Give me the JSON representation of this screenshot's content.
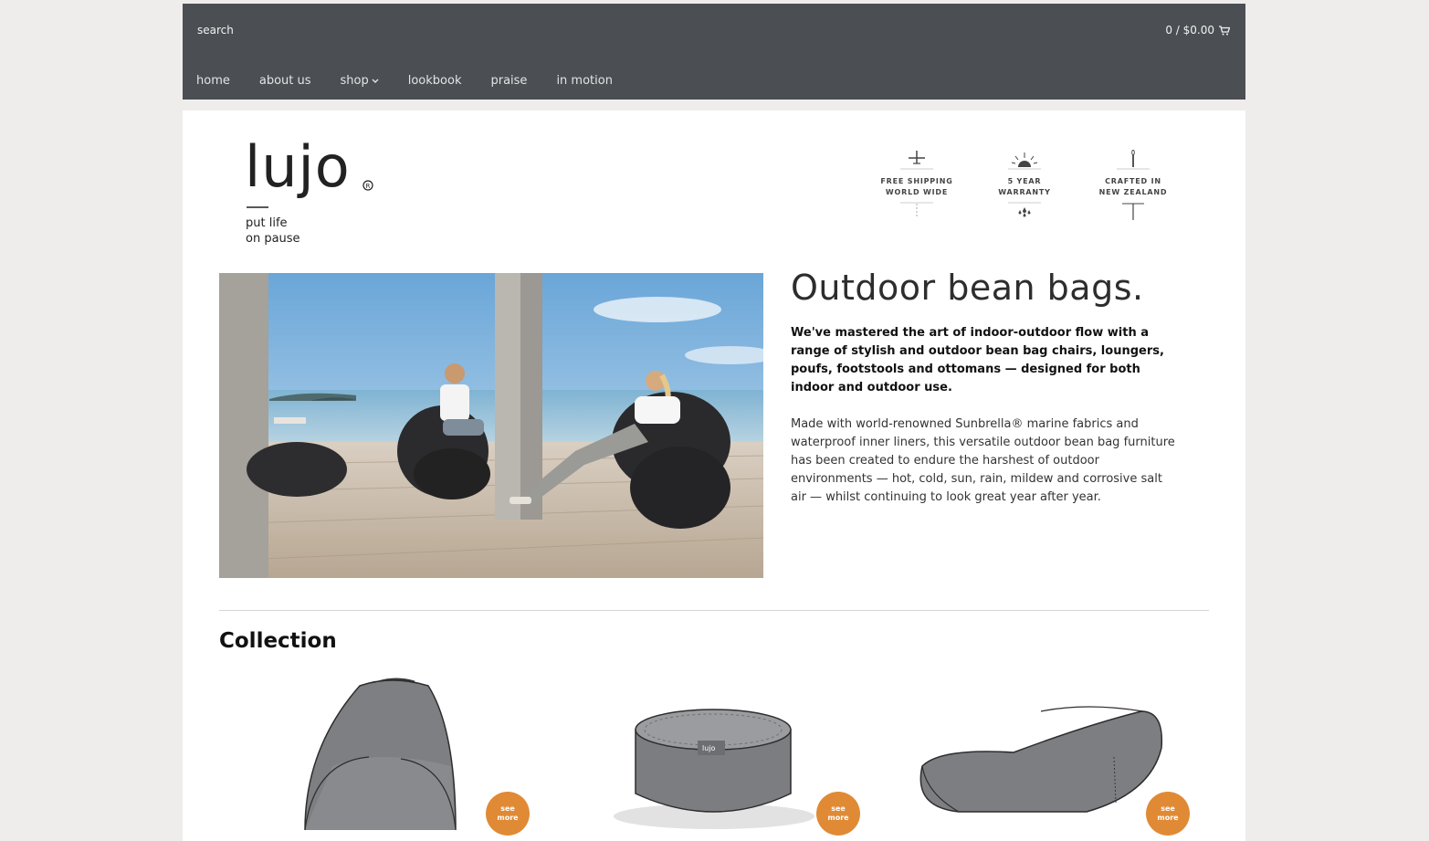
{
  "header": {
    "search_placeholder": "search",
    "cart": "0 / $0.00",
    "nav": [
      "home",
      "about us",
      "shop",
      "lookbook",
      "praise",
      "in motion"
    ]
  },
  "brand": {
    "logo": "lujo",
    "tagline_line1": "put life",
    "tagline_line2": "on pause"
  },
  "badges": [
    {
      "line1": "FREE SHIPPING",
      "line2": "WORLD WIDE",
      "icon": "plane-icon"
    },
    {
      "line1": "5 YEAR",
      "line2": "WARRANTY",
      "icon": "sun-rain-icon"
    },
    {
      "line1": "CRAFTED IN",
      "line2": "NEW ZEALAND",
      "icon": "needle-icon"
    }
  ],
  "main": {
    "heading": "Outdoor bean bags.",
    "lead": "We've mastered the art of indoor-outdoor flow with a range of stylish and outdoor bean bag chairs, loungers, poufs, footstools and ottomans — designed for both indoor and outdoor use.",
    "body": "Made with world-renowned Sunbrella® marine fabrics and waterproof inner liners, this versatile outdoor bean bag furniture has been created to endure the harshest of outdoor environments — hot, cold, sun, rain, mildew and corrosive salt air — whilst continuing to look great year after year."
  },
  "collection": {
    "title": "Collection",
    "see_more_line1": "see",
    "see_more_line2": "more",
    "product_label": "lujo"
  },
  "colors": {
    "topbar": "#4b4e53",
    "page_bg": "#eeedeb",
    "accent": "#e08a35",
    "product_grey": "#7d7f82"
  }
}
